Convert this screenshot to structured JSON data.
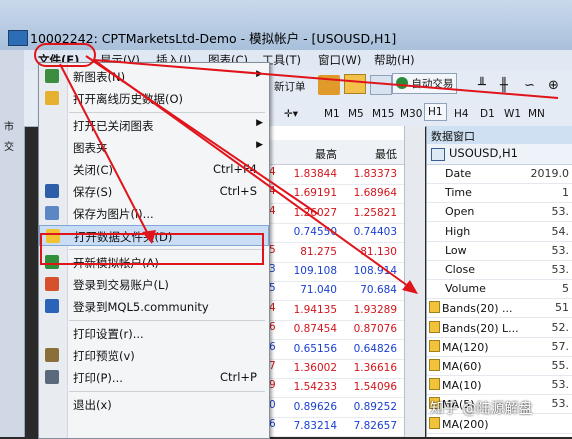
{
  "window": {
    "title": "10002242: CPTMarketsLtd-Demo - 模拟帐户 - [USOUSD,H1]"
  },
  "menubar": {
    "items": [
      "文件(F)",
      "显示(V)",
      "插入(I)",
      "图表(C)",
      "工具(T)",
      "窗口(W)",
      "帮助(H)"
    ]
  },
  "toolbar": {
    "new_order": "新订单",
    "auto_trading": "自动交易",
    "timeframes": [
      "M1",
      "M5",
      "M15",
      "M30",
      "H1",
      "H4",
      "D1",
      "W1",
      "MN"
    ]
  },
  "left_strip": {
    "labels": [
      "市",
      "交"
    ]
  },
  "file_menu": {
    "items": [
      {
        "label": "新图表(N)",
        "shortcut": "",
        "submenu": true,
        "icon": "new-chart-icon"
      },
      {
        "label": "打开离线历史数据(O)",
        "shortcut": "",
        "submenu": false,
        "icon": "open-offline-icon"
      },
      {
        "label": "打开已关闭图表",
        "shortcut": "",
        "submenu": true,
        "icon": ""
      },
      {
        "label": "图表夹",
        "shortcut": "",
        "submenu": true,
        "icon": ""
      },
      {
        "label": "关闭(C)",
        "shortcut": "Ctrl+F4",
        "submenu": false,
        "icon": ""
      },
      {
        "label": "保存(S)",
        "shortcut": "Ctrl+S",
        "submenu": false,
        "icon": "save-icon"
      },
      {
        "label": "保存为图片(i)...",
        "shortcut": "",
        "submenu": false,
        "icon": "save-picture-icon"
      },
      {
        "label": "打开数据文件夹(D)",
        "shortcut": "",
        "submenu": false,
        "icon": "folder-icon",
        "highlighted": true
      },
      {
        "label": "开新模拟帐户(A)",
        "shortcut": "",
        "submenu": false,
        "icon": "new-account-icon"
      },
      {
        "label": "登录到交易账户(L)",
        "shortcut": "",
        "submenu": false,
        "icon": "login-icon"
      },
      {
        "label": "登录到MQL5.community",
        "shortcut": "",
        "submenu": false,
        "icon": "mql5-icon"
      },
      {
        "label": "打印设置(r)...",
        "shortcut": "",
        "submenu": false,
        "icon": ""
      },
      {
        "label": "打印预览(v)",
        "shortcut": "",
        "submenu": false,
        "icon": "print-preview-icon"
      },
      {
        "label": "打印(P)...",
        "shortcut": "Ctrl+P",
        "submenu": false,
        "icon": "print-icon"
      },
      {
        "label": "退出(x)",
        "shortcut": "",
        "submenu": false,
        "icon": ""
      }
    ]
  },
  "quotes": {
    "headers": [
      "最高",
      "最低"
    ],
    "rows": [
      {
        "marker": "4",
        "high": "1.83844",
        "low": "1.83373",
        "color": "red"
      },
      {
        "marker": "4",
        "high": "1.69191",
        "low": "1.68964",
        "color": "red"
      },
      {
        "marker": "4",
        "high": "1.26027",
        "low": "1.25821",
        "color": "red"
      },
      {
        "marker": "",
        "high": "0.74550",
        "low": "0.74403",
        "color": "blue"
      },
      {
        "marker": "5",
        "high": "81.275",
        "low": "81.130",
        "color": "red"
      },
      {
        "marker": "3",
        "high": "109.108",
        "low": "108.914",
        "color": "blue"
      },
      {
        "marker": "5",
        "high": "71.040",
        "low": "70.684",
        "color": "blue"
      },
      {
        "marker": "4",
        "high": "1.94135",
        "low": "1.93289",
        "color": "red"
      },
      {
        "marker": "6",
        "high": "0.87454",
        "low": "0.87076",
        "color": "red"
      },
      {
        "marker": "6",
        "high": "0.65156",
        "low": "0.64826",
        "color": "blue"
      },
      {
        "marker": "7",
        "high": "1.36002",
        "low": "1.36616",
        "color": "red"
      },
      {
        "marker": "9",
        "high": "1.54233",
        "low": "1.54096",
        "color": "red"
      },
      {
        "marker": "0",
        "high": "0.89626",
        "low": "0.89252",
        "color": "blue"
      },
      {
        "marker": "6",
        "high": "7.83214",
        "low": "7.82657",
        "color": "blue"
      }
    ]
  },
  "data_window": {
    "title": "数据窗口",
    "symbol": "USOUSD,H1",
    "rows": [
      {
        "key": "Date",
        "value": "2019.0",
        "indicator": false
      },
      {
        "key": "Time",
        "value": "1",
        "indicator": false
      },
      {
        "key": "Open",
        "value": "53.",
        "indicator": false
      },
      {
        "key": "High",
        "value": "54.",
        "indicator": false
      },
      {
        "key": "Low",
        "value": "53.",
        "indicator": false
      },
      {
        "key": "Close",
        "value": "53.",
        "indicator": false
      },
      {
        "key": "Volume",
        "value": "5",
        "indicator": false
      },
      {
        "key": "Bands(20) ...",
        "value": "51",
        "indicator": true
      },
      {
        "key": "Bands(20) L...",
        "value": "52.",
        "indicator": true
      },
      {
        "key": "MA(120)",
        "value": "57.",
        "indicator": true
      },
      {
        "key": "MA(60)",
        "value": "55.",
        "indicator": true
      },
      {
        "key": "MA(10)",
        "value": "53.",
        "indicator": true
      },
      {
        "key": "MA(5)",
        "value": "53.",
        "indicator": true
      },
      {
        "key": "MA(200)",
        "value": "",
        "indicator": true
      }
    ]
  },
  "watermark": "知乎 @陆源解盘",
  "colors": {
    "annotation": "#e0141b",
    "highlight": "#c9ddf4"
  }
}
